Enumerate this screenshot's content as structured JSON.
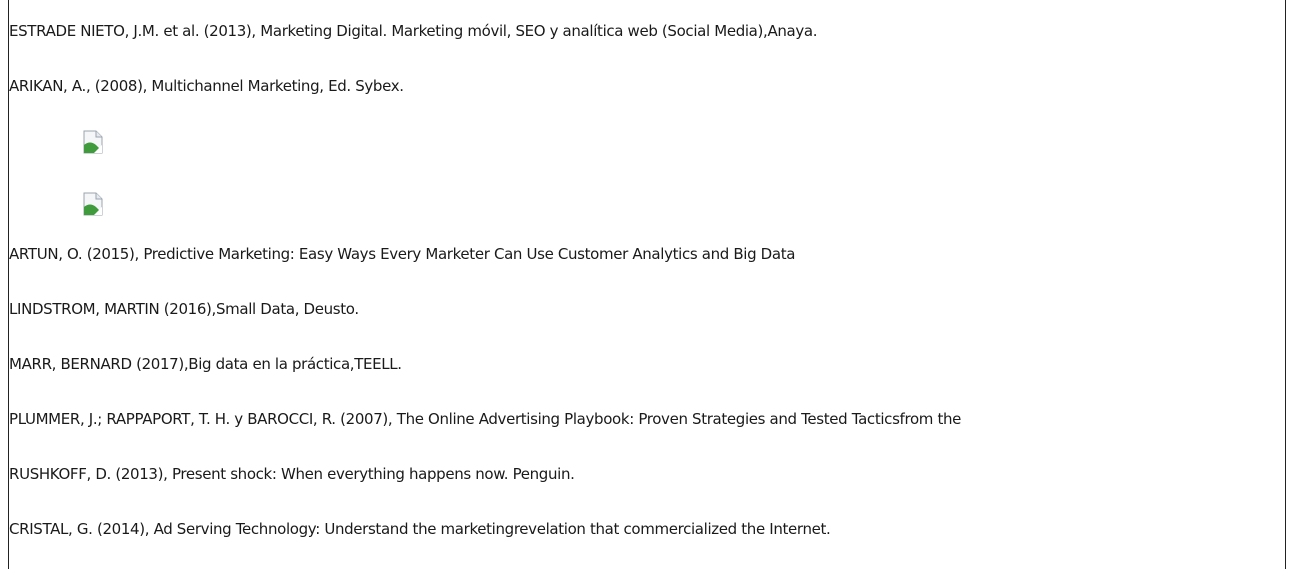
{
  "references": [
    "ESTRADE NIETO, J.M. et al. (2013), Marketing Digital. Marketing móvil, SEO y analítica web (Social Media),Anaya.",
    "ARIKAN, A., (2008), Multichannel Marketing, Ed. Sybex.",
    "ARTUN, O. (2015), Predictive Marketing: Easy Ways Every Marketer Can Use Customer Analytics and Big Data",
    "LINDSTROM, MARTIN (2016),Small Data, Deusto.",
    "MARR, BERNARD (2017),Big data en la práctica,TEELL.",
    "PLUMMER, J.; RAPPAPORT, T. H. y BAROCCI, R. (2007), The Online Advertising Playbook: Proven Strategies and Tested Tacticsfrom the",
    "RUSHKOFF, D. (2013), Present shock: When everything happens now. Penguin.",
    "CRISTAL, G. (2014), Ad Serving Technology: Understand the marketingrevelation that commercialized the Internet."
  ],
  "images": [
    {
      "icon": "broken-image-icon"
    },
    {
      "icon": "broken-image-icon"
    }
  ]
}
